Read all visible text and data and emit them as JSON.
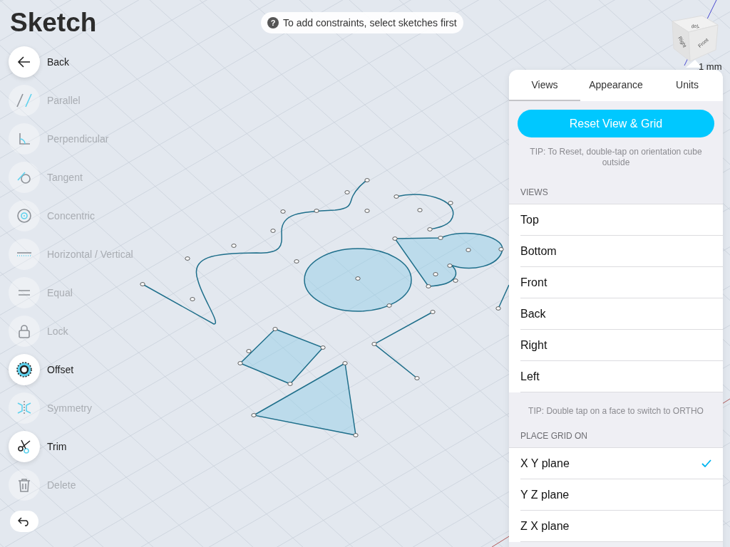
{
  "title": "Sketch",
  "hint": {
    "icon": "?",
    "text": "To add constraints, select sketches first"
  },
  "tools": [
    {
      "kind": "back",
      "label": "Back",
      "enabled": true
    },
    {
      "kind": "parallel",
      "label": "Parallel",
      "enabled": false
    },
    {
      "kind": "perpendicular",
      "label": "Perpendicular",
      "enabled": false
    },
    {
      "kind": "tangent",
      "label": "Tangent",
      "enabled": false
    },
    {
      "kind": "concentric",
      "label": "Concentric",
      "enabled": false
    },
    {
      "kind": "horizontal",
      "label": "Horizontal / Vertical",
      "enabled": false
    },
    {
      "kind": "equal",
      "label": "Equal",
      "enabled": false
    },
    {
      "kind": "lock",
      "label": "Lock",
      "enabled": false
    },
    {
      "kind": "offset",
      "label": "Offset",
      "enabled": true
    },
    {
      "kind": "symmetry",
      "label": "Symmetry",
      "enabled": false
    },
    {
      "kind": "trim",
      "label": "Trim",
      "enabled": true
    },
    {
      "kind": "delete",
      "label": "Delete",
      "enabled": false
    }
  ],
  "cube": {
    "faces": [
      "Top",
      "Right",
      "Front"
    ],
    "scale": "1 mm"
  },
  "panel": {
    "tabs": [
      {
        "label": "Views",
        "selected": true
      },
      {
        "label": "Appearance",
        "selected": false
      },
      {
        "label": "Units",
        "selected": false
      }
    ],
    "reset_button": "Reset View & Grid",
    "reset_tip": "TIP: To Reset, double-tap on orientation cube outside",
    "views_header": "VIEWS",
    "views": [
      "Top",
      "Bottom",
      "Front",
      "Back",
      "Right",
      "Left"
    ],
    "ortho_tip": "TIP: Double tap on a face to switch to ORTHO",
    "grid_header": "PLACE GRID ON",
    "planes": [
      {
        "label": "X Y plane",
        "selected": true
      },
      {
        "label": "Y Z plane",
        "selected": false
      },
      {
        "label": "Z X plane",
        "selected": false
      }
    ]
  }
}
